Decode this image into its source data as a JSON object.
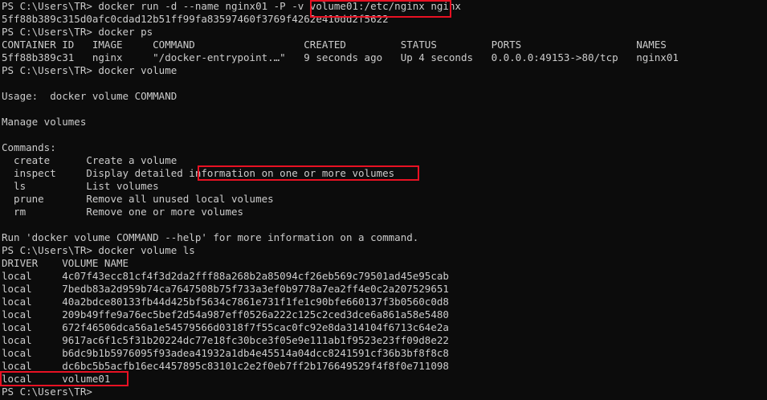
{
  "terminal": {
    "line01": "PS C:\\Users\\TR> docker run -d --name nginx01 -P -v volume01:/etc/nginx nginx",
    "line02": "5ff88b389c315d0afc0cdad12b51ff99fa83597460f3769f4262e410dd2f5622",
    "line03": "PS C:\\Users\\TR> docker ps",
    "line04": "CONTAINER ID   IMAGE     COMMAND                  CREATED         STATUS         PORTS                   NAMES",
    "line05": "5ff88b389c31   nginx     \"/docker-entrypoint.…\"   9 seconds ago   Up 4 seconds   0.0.0.0:49153->80/tcp   nginx01",
    "line06": "PS C:\\Users\\TR> docker volume",
    "line07": "",
    "line08": "Usage:  docker volume COMMAND",
    "line09": "",
    "line10": "Manage volumes",
    "line11": "",
    "line12": "Commands:",
    "line13": "  create      Create a volume",
    "line14": "  inspect     Display detailed information on one or more volumes",
    "line15": "  ls          List volumes",
    "line16": "  prune       Remove all unused local volumes",
    "line17": "  rm          Remove one or more volumes",
    "line18": "",
    "line19": "Run 'docker volume COMMAND --help' for more information on a command.",
    "line20": "PS C:\\Users\\TR> docker volume ls",
    "line21": "DRIVER    VOLUME NAME",
    "line22": "local     4c07f43ecc81cf4f3d2da2fff88a268b2a85094cf26eb569c79501ad45e95cab",
    "line23": "local     7bedb83a2d959b74ca7647508b75f733a3ef0b9778a7ea2ff4e0c2a207529651",
    "line24": "local     40a2bdce80133fb44d425bf5634c7861e731f1fe1c90bfe660137f3b0560c0d8",
    "line25": "local     209b49ffe9a76ec5bef2d54a987eff0526a222c125c2ced3dce6a861a58e5480",
    "line26": "local     672f46506dca56a1e54579566d0318f7f55cac0fc92e8da314104f6713c64e2a",
    "line27": "local     9617ac6f1c5f31b20224dc77e18fc30bce3f05e9e111ab1f9523e23ff09d8e22",
    "line28": "local     b6dc9b1b5976095f93adea41932a1db4e45514a04dcc8241591cf36b3bf8f8c8",
    "line29": "local     dc6bc5b5acfb16ec4457895c83101c2e2f0eb7ff2b176649529f4f8f0e711098",
    "line30": "local     volume01",
    "line31": "PS C:\\Users\\TR> "
  },
  "colors": {
    "background": "#0c0c0c",
    "foreground": "#cccccc",
    "highlight": "#e81123"
  }
}
